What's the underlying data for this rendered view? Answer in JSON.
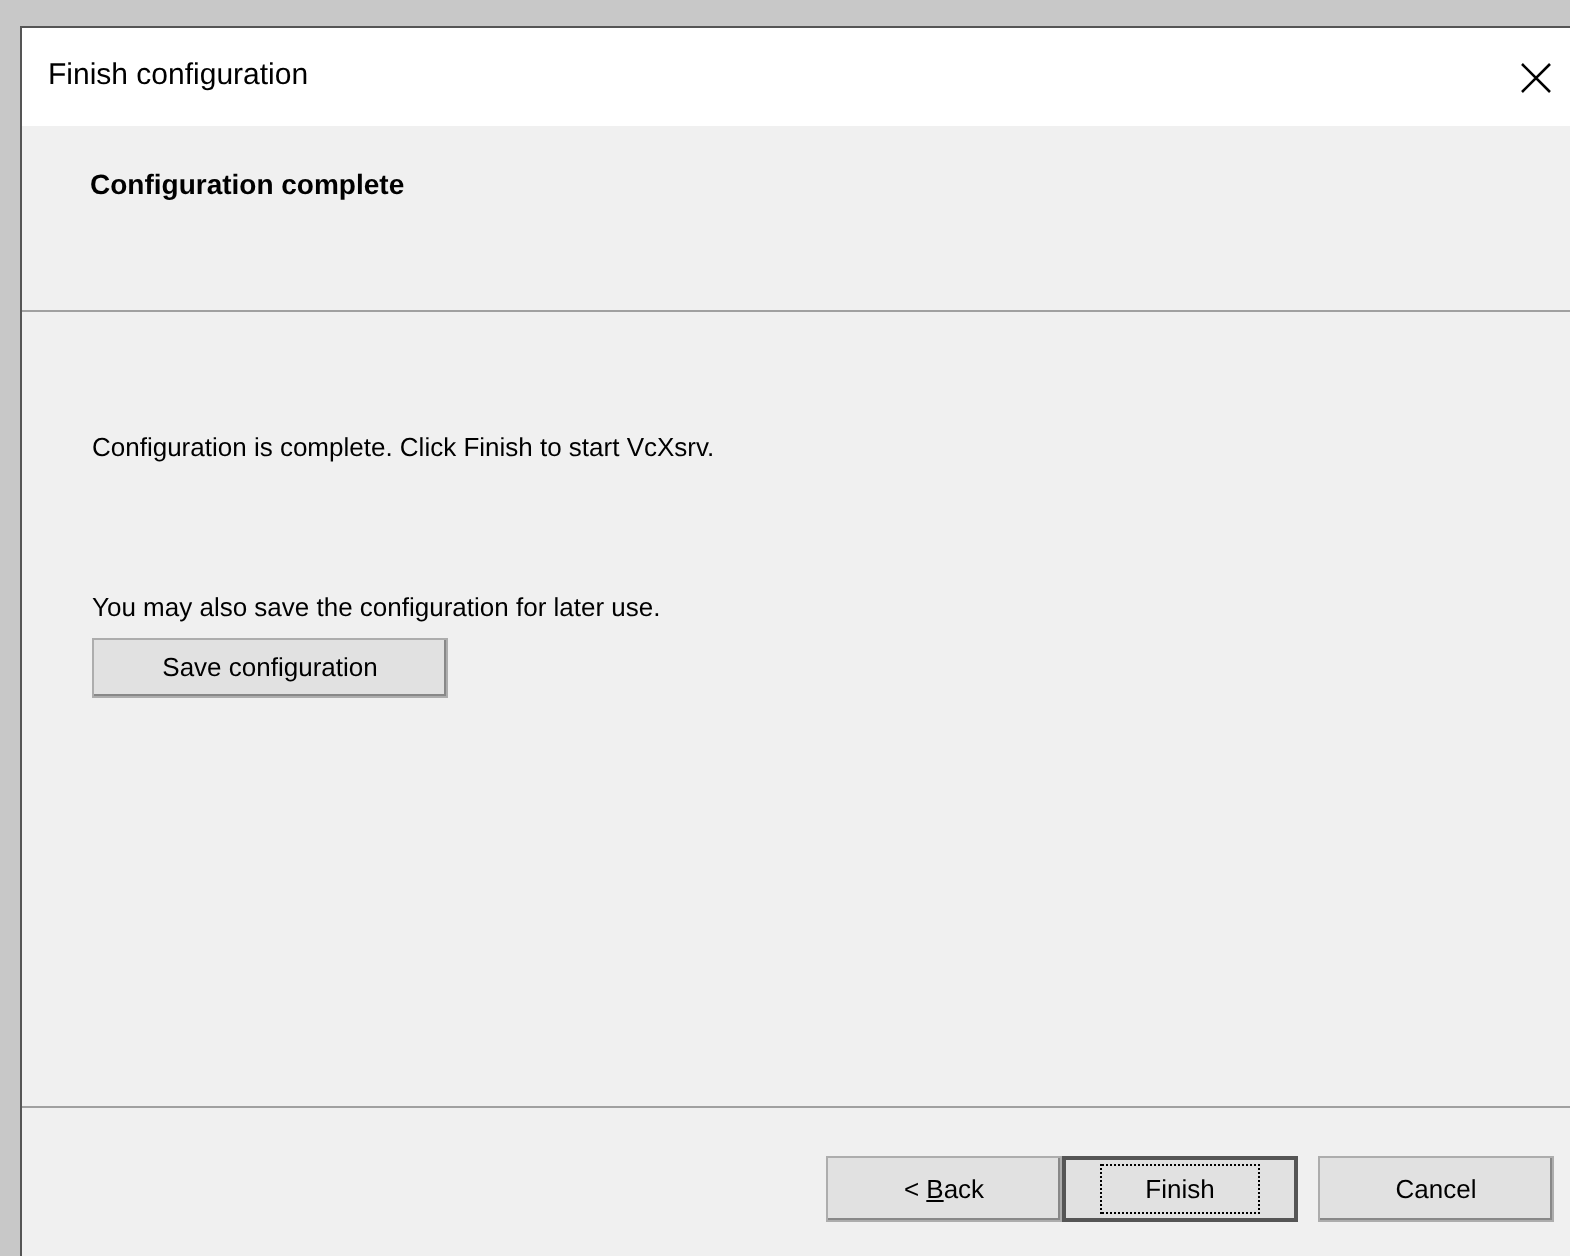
{
  "window": {
    "title": "Finish configuration"
  },
  "header": {
    "title": "Configuration complete"
  },
  "body": {
    "message": "Configuration is complete. Click Finish to start VcXsrv.",
    "save_hint": "You may also save the configuration for later use.",
    "save_button": "Save configuration"
  },
  "buttons": [
    {
      "label_parts": [
        "< ",
        "B",
        "ack"
      ],
      "default": false,
      "focused": false
    },
    {
      "label_parts": [
        "Finish"
      ],
      "default": true,
      "focused": true
    },
    {
      "label_parts": [
        "Cancel"
      ],
      "default": false,
      "focused": false
    }
  ]
}
